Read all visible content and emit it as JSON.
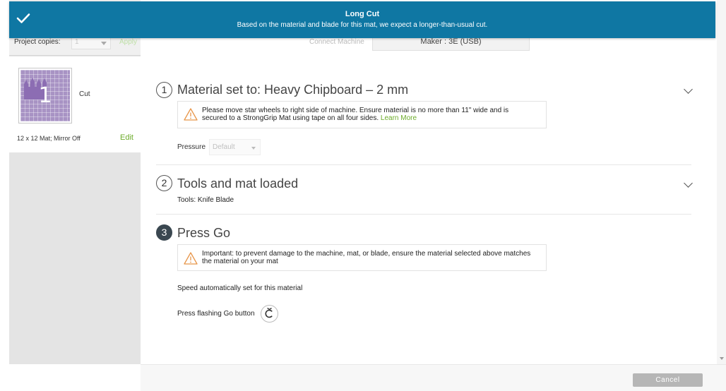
{
  "banner": {
    "title": "Long Cut",
    "message": "Based on the material and blade for this mat, we expect a longer-than-usual cut.",
    "color": "#0f77a3"
  },
  "sidebar": {
    "copies_label": "Project copies:",
    "copies_value": "1",
    "apply_label": "Apply",
    "mat": {
      "number": "1",
      "mode": "Cut",
      "info": "12 x 12 Mat; Mirror Off",
      "edit_label": "Edit"
    }
  },
  "header": {
    "connect_label": "Connect Machine",
    "machine": "Maker : 3E (USB)"
  },
  "steps": [
    {
      "number": "1",
      "title": "Material set to: Heavy Chipboard – 2 mm",
      "notice": "Please move star wheels to right side of machine. Ensure material is no more than 11\" wide and is secured to a StrongGrip Mat using tape on all four sides.",
      "learn_more": "Learn More",
      "pressure_label": "Pressure",
      "pressure_value": "Default"
    },
    {
      "number": "2",
      "title": "Tools and mat loaded",
      "tools": "Tools: Knife Blade"
    },
    {
      "number": "3",
      "title": "Press Go",
      "notice": "Important: to prevent damage to the machine, mat, or blade, ensure the material selected above matches the material on your mat",
      "speed_text": "Speed automatically set for this material",
      "press_text": "Press flashing Go button"
    }
  ],
  "footer": {
    "cancel_label": "Cancel"
  },
  "icons": {
    "banner": "checkmark-icon",
    "warning": "warning-triangle-icon",
    "go": "cricut-go-icon",
    "collapse": "chevron-down-icon"
  }
}
